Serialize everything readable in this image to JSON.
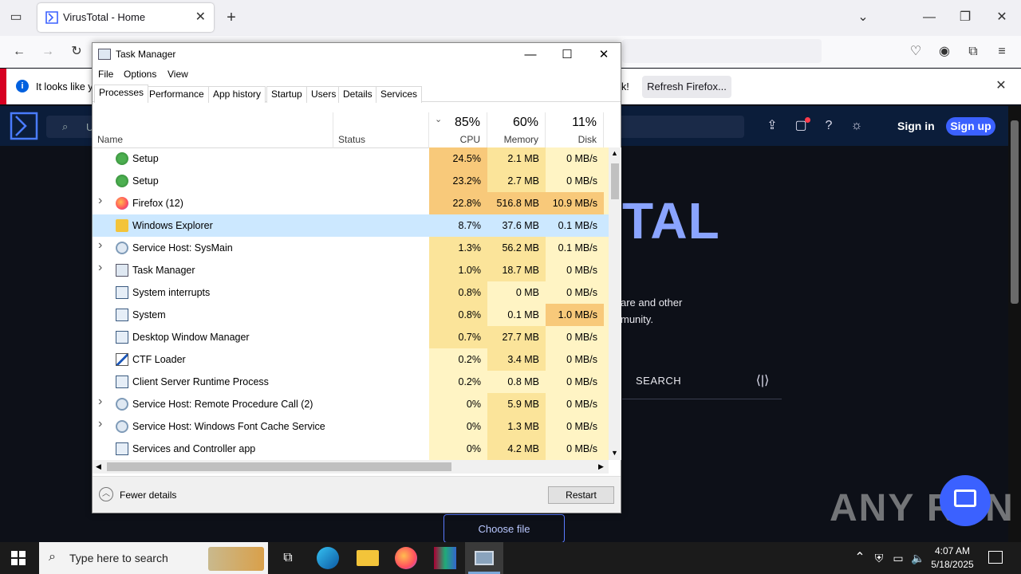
{
  "browser": {
    "tab_title": "VirusTotal - Home",
    "notification_text": "It looks like y",
    "notification_tail": "k!",
    "refresh_button": "Refresh Firefox..."
  },
  "site": {
    "sign_in": "Sign in",
    "sign_up": "Sign up",
    "search_placeholder": "U",
    "hero_partial": "TAL",
    "desc_line1": "are and other",
    "desc_line2": "munity.",
    "search_tab": "SEARCH",
    "choose_file": "Choose file",
    "watermark": "ANY RUN"
  },
  "task_manager": {
    "title": "Task Manager",
    "menu": [
      "File",
      "Options",
      "View"
    ],
    "tabs": [
      "Processes",
      "Performance",
      "App history",
      "Startup",
      "Users",
      "Details",
      "Services"
    ],
    "active_tab": "Processes",
    "columns": {
      "name": "Name",
      "status": "Status",
      "cpu_pct": "85%",
      "cpu": "CPU",
      "mem_pct": "60%",
      "mem": "Memory",
      "disk_pct": "11%",
      "disk": "Disk"
    },
    "rows": [
      {
        "name": "Setup",
        "cpu": "24.5%",
        "mem": "2.1 MB",
        "disk": "0 MB/s",
        "expand": false,
        "icon": "setup-icon"
      },
      {
        "name": "Setup",
        "cpu": "23.2%",
        "mem": "2.7 MB",
        "disk": "0 MB/s",
        "expand": false,
        "icon": "setup-icon"
      },
      {
        "name": "Firefox (12)",
        "cpu": "22.8%",
        "mem": "516.8 MB",
        "disk": "10.9 MB/s",
        "expand": true,
        "icon": "firefox-icon"
      },
      {
        "name": "Windows Explorer",
        "cpu": "8.7%",
        "mem": "37.6 MB",
        "disk": "0.1 MB/s",
        "expand": false,
        "icon": "folder-icon",
        "selected": true
      },
      {
        "name": "Service Host: SysMain",
        "cpu": "1.3%",
        "mem": "56.2 MB",
        "disk": "0.1 MB/s",
        "expand": true,
        "icon": "gear-icon"
      },
      {
        "name": "Task Manager",
        "cpu": "1.0%",
        "mem": "18.7 MB",
        "disk": "0 MB/s",
        "expand": true,
        "icon": "taskmgr-icon"
      },
      {
        "name": "System interrupts",
        "cpu": "0.8%",
        "mem": "0 MB",
        "disk": "0 MB/s",
        "expand": false,
        "icon": "window-icon"
      },
      {
        "name": "System",
        "cpu": "0.8%",
        "mem": "0.1 MB",
        "disk": "1.0 MB/s",
        "expand": false,
        "icon": "window-icon"
      },
      {
        "name": "Desktop Window Manager",
        "cpu": "0.7%",
        "mem": "27.7 MB",
        "disk": "0 MB/s",
        "expand": false,
        "icon": "window-icon"
      },
      {
        "name": "CTF Loader",
        "cpu": "0.2%",
        "mem": "3.4 MB",
        "disk": "0 MB/s",
        "expand": false,
        "icon": "pen-icon"
      },
      {
        "name": "Client Server Runtime Process",
        "cpu": "0.2%",
        "mem": "0.8 MB",
        "disk": "0 MB/s",
        "expand": false,
        "icon": "window-icon"
      },
      {
        "name": "Service Host: Remote Procedure Call (2)",
        "cpu": "0%",
        "mem": "5.9 MB",
        "disk": "0 MB/s",
        "expand": true,
        "icon": "gear-icon"
      },
      {
        "name": "Service Host: Windows Font Cache Service",
        "cpu": "0%",
        "mem": "1.3 MB",
        "disk": "0 MB/s",
        "expand": true,
        "icon": "gear-icon"
      },
      {
        "name": "Services and Controller app",
        "cpu": "0%",
        "mem": "4.2 MB",
        "disk": "0 MB/s",
        "expand": false,
        "icon": "window-icon"
      }
    ],
    "fewer_details": "Fewer details",
    "restart": "Restart"
  },
  "taskbar": {
    "search_placeholder": "Type here to search",
    "time": "4:07 AM",
    "date": "5/18/2025"
  },
  "colors": {
    "cpu_high": "#f8c97a",
    "cpu_mid": "#fbe49a",
    "cpu_low": "#fff4c4",
    "selected_row": "#cce8ff",
    "vt_accent": "#3b61ff"
  }
}
